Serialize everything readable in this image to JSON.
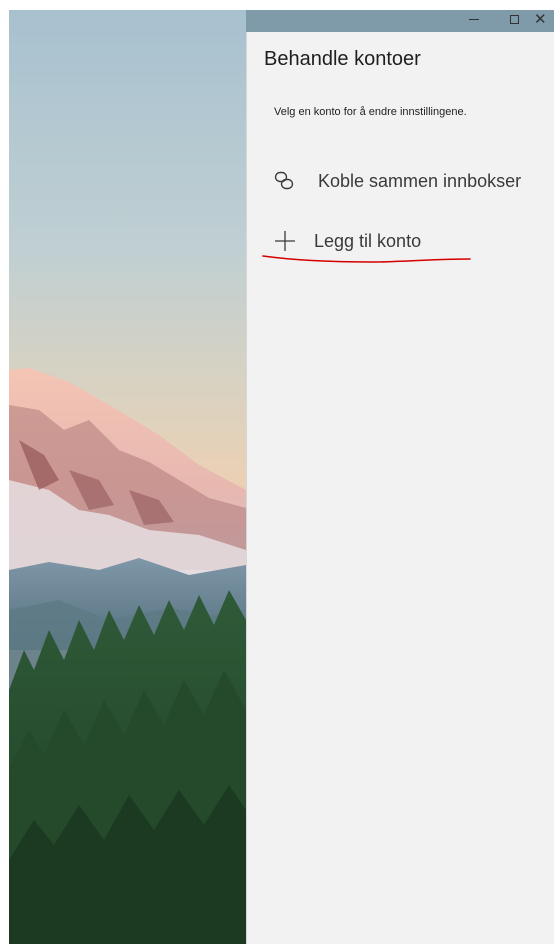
{
  "window": {
    "controls": {
      "minimize_icon": "minimize-icon",
      "maximize_icon": "maximize-icon",
      "close_icon": "close-icon",
      "close_glyph": "✕"
    }
  },
  "panel": {
    "title": "Behandle kontoer",
    "subtitle": "Velg en konto for å endre innstillingene.",
    "items": [
      {
        "label": "Koble sammen innbokser",
        "icon": "link-icon"
      },
      {
        "label": "Legg til konto",
        "icon": "plus-icon"
      }
    ]
  },
  "colors": {
    "panel_background": "#f2f2f2",
    "text": "#1f1f1f",
    "annotation": "#d40000"
  }
}
